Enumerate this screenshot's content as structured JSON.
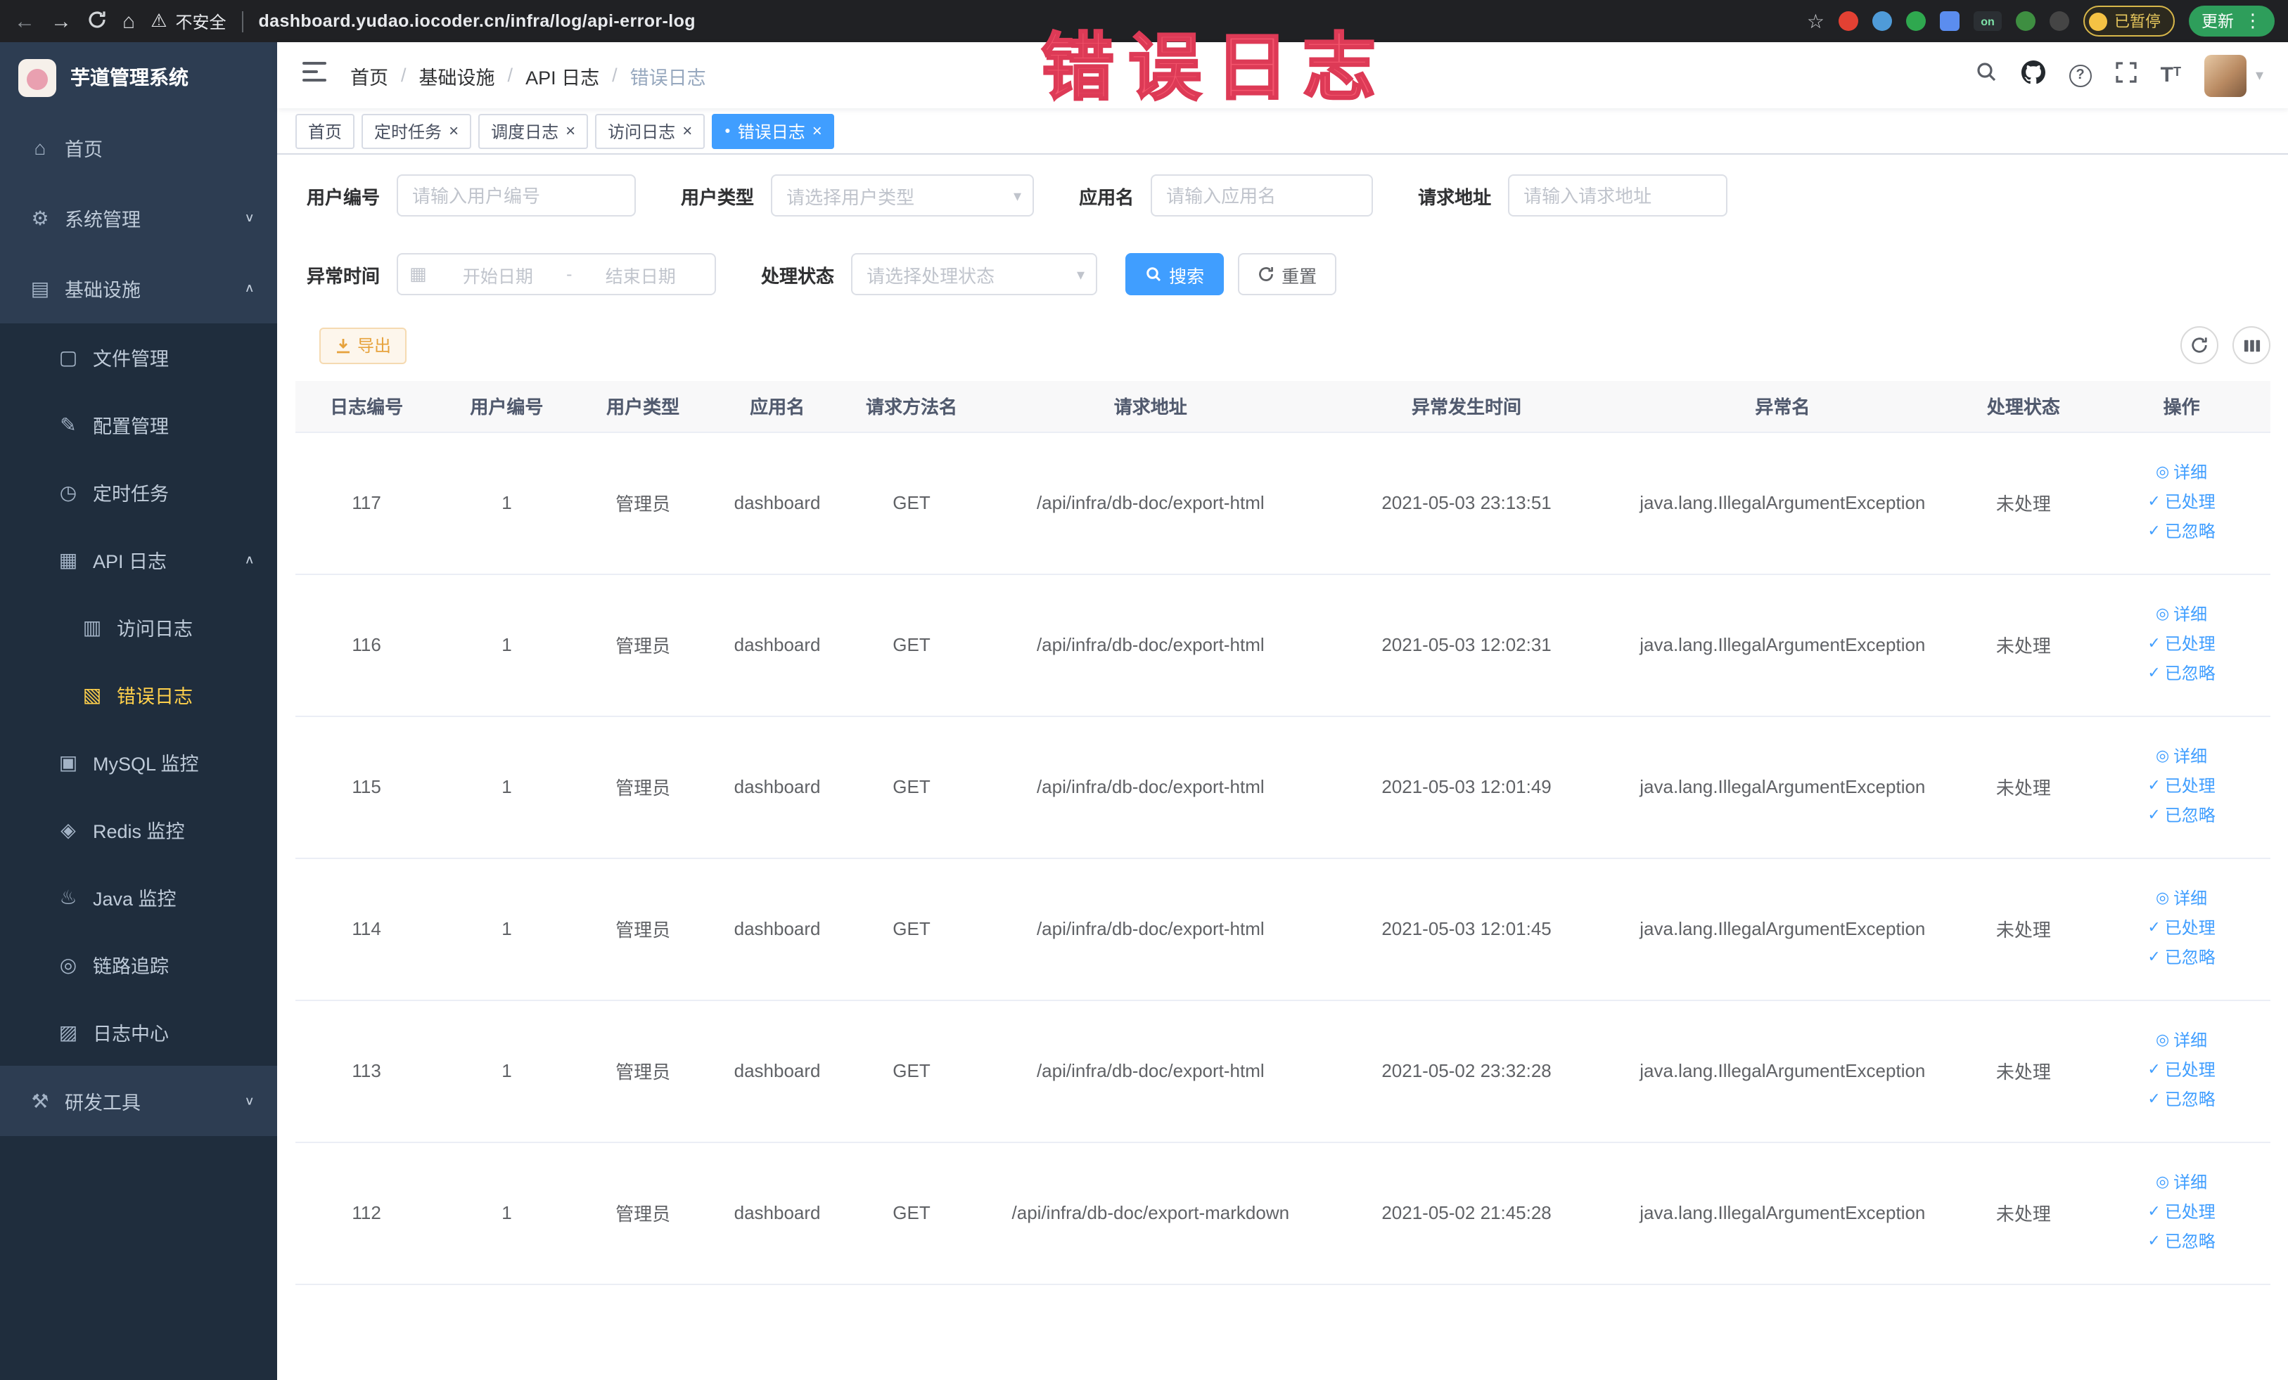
{
  "browser": {
    "security_label": "不安全",
    "url": "dashboard.yudao.iocoder.cn/infra/log/api-error-log",
    "extension_badge": "on",
    "paused_badge": "已暂停",
    "update_button": "更新"
  },
  "annotation": "错误日志",
  "sidebar": {
    "logo_title": "芋道管理系统",
    "items": [
      {
        "label": "首页",
        "glyph": "⌂"
      },
      {
        "label": "系统管理",
        "glyph": "⚙"
      },
      {
        "label": "基础设施",
        "glyph": "▤"
      },
      {
        "label": "文件管理",
        "glyph": "▢"
      },
      {
        "label": "配置管理",
        "glyph": "✎"
      },
      {
        "label": "定时任务",
        "glyph": "◷"
      },
      {
        "label": "API 日志",
        "glyph": "▦"
      },
      {
        "label": "访问日志",
        "glyph": "▥"
      },
      {
        "label": "错误日志",
        "glyph": "▧"
      },
      {
        "label": "MySQL 监控",
        "glyph": "▣"
      },
      {
        "label": "Redis 监控",
        "glyph": "◈"
      },
      {
        "label": "Java 监控",
        "glyph": "♨"
      },
      {
        "label": "链路追踪",
        "glyph": "◎"
      },
      {
        "label": "日志中心",
        "glyph": "▨"
      },
      {
        "label": "研发工具",
        "glyph": "⚒"
      }
    ]
  },
  "header": {
    "breadcrumb": [
      {
        "label": "首页"
      },
      {
        "label": "基础设施"
      },
      {
        "label": "API 日志"
      },
      {
        "label": "错误日志"
      }
    ],
    "breadcrumb_separator": "/"
  },
  "tabs": [
    {
      "label": "首页"
    },
    {
      "label": "定时任务"
    },
    {
      "label": "调度日志"
    },
    {
      "label": "访问日志"
    },
    {
      "label": "错误日志"
    }
  ],
  "filters": {
    "user_id": {
      "label": "用户编号",
      "placeholder": "请输入用户编号"
    },
    "user_type": {
      "label": "用户类型",
      "placeholder": "请选择用户类型"
    },
    "app_name": {
      "label": "应用名",
      "placeholder": "请输入应用名"
    },
    "request_url": {
      "label": "请求地址",
      "placeholder": "请输入请求地址"
    },
    "exception_time": {
      "label": "异常时间",
      "start_placeholder": "开始日期",
      "separator": "-",
      "end_placeholder": "结束日期"
    },
    "process_status": {
      "label": "处理状态",
      "placeholder": "请选择处理状态"
    },
    "search_button": "搜索",
    "reset_button": "重置"
  },
  "toolbar": {
    "export_button": "导出"
  },
  "table": {
    "columns": [
      "日志编号",
      "用户编号",
      "用户类型",
      "应用名",
      "请求方法名",
      "请求地址",
      "异常发生时间",
      "异常名",
      "处理状态",
      "操作"
    ],
    "row_actions": [
      "详细",
      "已处理",
      "已忽略"
    ],
    "rows": [
      {
        "id": "117",
        "user_id": "1",
        "user_type": "管理员",
        "app": "dashboard",
        "method": "GET",
        "url": "/api/infra/db-doc/export-html",
        "time": "2021-05-03 23:13:51",
        "exception": "java.lang.IllegalArgumentException",
        "status": "未处理"
      },
      {
        "id": "116",
        "user_id": "1",
        "user_type": "管理员",
        "app": "dashboard",
        "method": "GET",
        "url": "/api/infra/db-doc/export-html",
        "time": "2021-05-03 12:02:31",
        "exception": "java.lang.IllegalArgumentException",
        "status": "未处理"
      },
      {
        "id": "115",
        "user_id": "1",
        "user_type": "管理员",
        "app": "dashboard",
        "method": "GET",
        "url": "/api/infra/db-doc/export-html",
        "time": "2021-05-03 12:01:49",
        "exception": "java.lang.IllegalArgumentException",
        "status": "未处理"
      },
      {
        "id": "114",
        "user_id": "1",
        "user_type": "管理员",
        "app": "dashboard",
        "method": "GET",
        "url": "/api/infra/db-doc/export-html",
        "time": "2021-05-03 12:01:45",
        "exception": "java.lang.IllegalArgumentException",
        "status": "未处理"
      },
      {
        "id": "113",
        "user_id": "1",
        "user_type": "管理员",
        "app": "dashboard",
        "method": "GET",
        "url": "/api/infra/db-doc/export-html",
        "time": "2021-05-02 23:32:28",
        "exception": "java.lang.IllegalArgumentException",
        "status": "未处理"
      },
      {
        "id": "112",
        "user_id": "1",
        "user_type": "管理员",
        "app": "dashboard",
        "method": "GET",
        "url": "/api/infra/db-doc/export-markdown",
        "time": "2021-05-02 21:45:28",
        "exception": "java.lang.IllegalArgumentException",
        "status": "未处理"
      }
    ]
  },
  "icons": {
    "close": "×",
    "active_dot": "●",
    "chevron_up": "∧",
    "chevron_down": "∨",
    "select_caret": "▾",
    "calendar": "▦",
    "eye": "◎",
    "check": "✓",
    "menu_dots": "⋮",
    "star": "☆",
    "warning": "⚠",
    "back": "←",
    "forward": "→",
    "home": "⌂",
    "question": "?",
    "text_size": "T",
    "avatar_caret": "▾"
  },
  "colors": {
    "accent": "#409eff",
    "sidebar_active": "#ffd04b",
    "warning_button": "#e6a23c",
    "annotation_red": "#f4566e"
  }
}
